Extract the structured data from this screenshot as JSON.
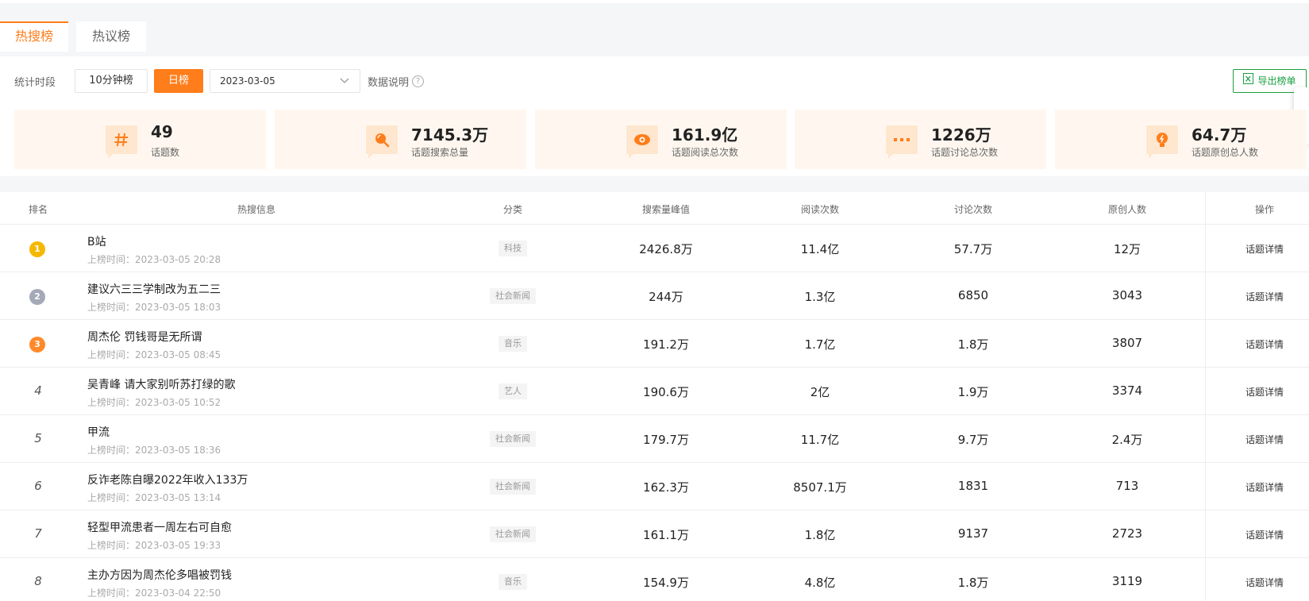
{
  "tabs": [
    {
      "label": "热搜榜",
      "active": true
    },
    {
      "label": "热议榜",
      "active": false
    }
  ],
  "toolbar": {
    "period_label": "统计时段",
    "btn_10min": "10分钟榜",
    "btn_day": "日榜",
    "date_value": "2023-03-05",
    "data_note": "数据说明",
    "help_glyph": "?",
    "export_label": "导出榜单"
  },
  "stats": [
    {
      "value": "49",
      "label": "话题数",
      "icon": "hash-icon"
    },
    {
      "value": "7145.3万",
      "label": "话题搜索总量",
      "icon": "search-icon"
    },
    {
      "value": "161.9亿",
      "label": "话题阅读总次数",
      "icon": "eye-icon"
    },
    {
      "value": "1226万",
      "label": "话题讨论总次数",
      "icon": "comment-dots-icon"
    },
    {
      "value": "64.7万",
      "label": "话题原创总人数",
      "icon": "lightbulb-icon"
    }
  ],
  "table": {
    "headers": [
      "排名",
      "热搜信息",
      "分类",
      "搜索量峰值",
      "阅读次数",
      "讨论次数",
      "原创人数",
      "操作"
    ],
    "time_prefix": "上榜时间：",
    "detail_label": "话题详情",
    "rows": [
      {
        "rank": "1",
        "title": "B站",
        "time": "2023-03-05 20:28",
        "category": "科技",
        "peak": "2426.8万",
        "reads": "11.4亿",
        "discussions": "57.7万",
        "originals": "12万"
      },
      {
        "rank": "2",
        "title": "建议六三三学制改为五二三",
        "time": "2023-03-05 18:03",
        "category": "社会新闻",
        "peak": "244万",
        "reads": "1.3亿",
        "discussions": "6850",
        "originals": "3043"
      },
      {
        "rank": "3",
        "title": "周杰伦 罚钱哥是无所谓",
        "time": "2023-03-05 08:45",
        "category": "音乐",
        "peak": "191.2万",
        "reads": "1.7亿",
        "discussions": "1.8万",
        "originals": "3807"
      },
      {
        "rank": "4",
        "title": "吴青峰 请大家别听苏打绿的歌",
        "time": "2023-03-05 10:52",
        "category": "艺人",
        "peak": "190.6万",
        "reads": "2亿",
        "discussions": "1.9万",
        "originals": "3374"
      },
      {
        "rank": "5",
        "title": "甲流",
        "time": "2023-03-05 18:36",
        "category": "社会新闻",
        "peak": "179.7万",
        "reads": "11.7亿",
        "discussions": "9.7万",
        "originals": "2.4万"
      },
      {
        "rank": "6",
        "title": "反诈老陈自曝2022年收入133万",
        "time": "2023-03-05 13:14",
        "category": "社会新闻",
        "peak": "162.3万",
        "reads": "8507.1万",
        "discussions": "1831",
        "originals": "713"
      },
      {
        "rank": "7",
        "title": "轻型甲流患者一周左右可自愈",
        "time": "2023-03-05 19:33",
        "category": "社会新闻",
        "peak": "161.1万",
        "reads": "1.8亿",
        "discussions": "9137",
        "originals": "2723"
      },
      {
        "rank": "8",
        "title": "主办方因为周杰伦多唱被罚钱",
        "time": "2023-03-04 22:50",
        "category": "音乐",
        "peak": "154.9万",
        "reads": "4.8亿",
        "discussions": "1.8万",
        "originals": "3119"
      }
    ]
  },
  "colors": {
    "accent": "#ff7d1a",
    "export_green": "#1aa040",
    "gold": "#f5b800",
    "silver": "#a3a9b6",
    "bronze": "#ff8a2a"
  }
}
